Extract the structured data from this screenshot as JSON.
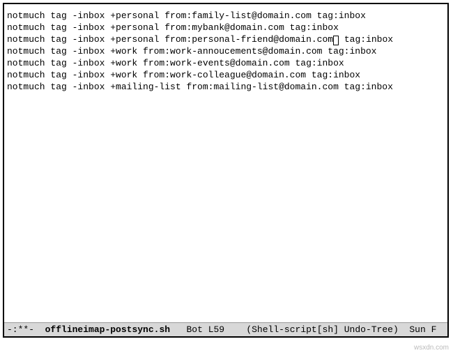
{
  "buffer": {
    "lines": [
      "",
      "notmuch tag -inbox +personal from:family-list@domain.com tag:inbox",
      "notmuch tag -inbox +personal from:mybank@domain.com tag:inbox",
      "notmuch tag -inbox +personal from:personal-friend@domain.com tag:inbox",
      "",
      "notmuch tag -inbox +work from:work-annoucements@domain.com tag:inbox",
      "notmuch tag -inbox +work from:work-events@domain.com tag:inbox",
      "notmuch tag -inbox +work from:work-colleague@domain.com tag:inbox",
      "",
      "notmuch tag -inbox +mailing-list from:mailing-list@domain.com tag:inbox"
    ],
    "cursor": {
      "line_index": 3,
      "col_after_text": "notmuch tag -inbox +personal from:personal-friend@domain.com",
      "tail": " tag:inbox"
    }
  },
  "modeline": {
    "status": "-:**-",
    "filename": "offlineimap-postsync.sh",
    "position": "Bot",
    "line": "L59",
    "modes": "(Shell-script[sh] Undo-Tree)",
    "right": "Sun F"
  },
  "watermark": "wsxdn.com"
}
